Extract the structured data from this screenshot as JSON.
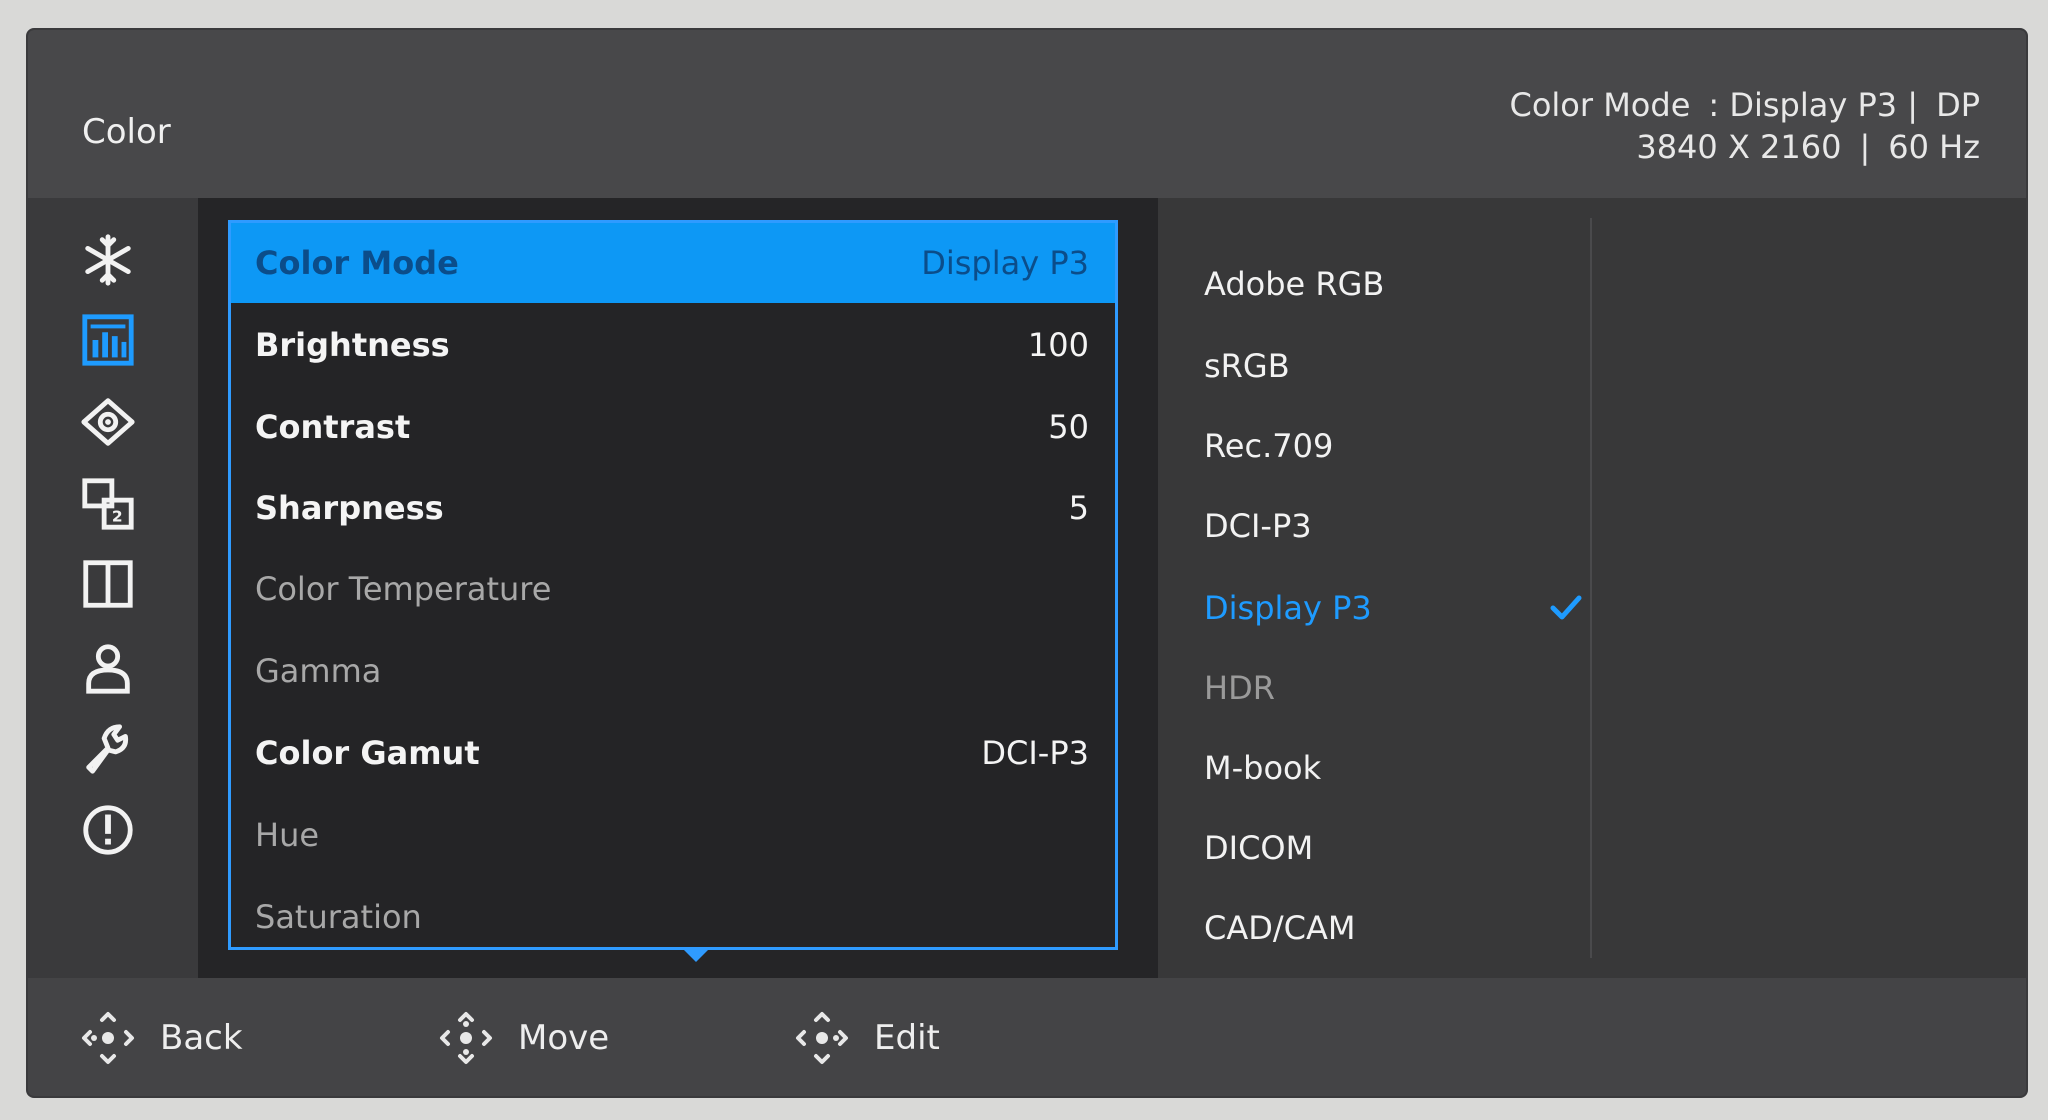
{
  "header": {
    "title": "Color",
    "info_line1": [
      "Color Mode",
      ": Display P3 |",
      "DP"
    ],
    "info_line2": [
      "3840 X 2160",
      "|",
      "60 Hz"
    ]
  },
  "rail": {
    "icons": [
      "snowflake-icon",
      "color-chart-icon",
      "eye-icon",
      "picture-in-picture-icon",
      "split-screen-icon",
      "user-icon",
      "wrench-icon",
      "info-icon"
    ],
    "active_index": 1
  },
  "menu": {
    "items": [
      {
        "label": "Color Mode",
        "value": "Display P3",
        "state": "active"
      },
      {
        "label": "Brightness",
        "value": "100",
        "state": "enabled"
      },
      {
        "label": "Contrast",
        "value": "50",
        "state": "enabled"
      },
      {
        "label": "Sharpness",
        "value": "5",
        "state": "enabled"
      },
      {
        "label": "Color Temperature",
        "value": "",
        "state": "disabled"
      },
      {
        "label": "Gamma",
        "value": "",
        "state": "disabled"
      },
      {
        "label": "Color Gamut",
        "value": "DCI-P3",
        "state": "enabled"
      },
      {
        "label": "Hue",
        "value": "",
        "state": "disabled"
      },
      {
        "label": "Saturation",
        "value": "",
        "state": "disabled"
      }
    ]
  },
  "options": {
    "items": [
      {
        "label": "Adobe RGB",
        "state": "enabled"
      },
      {
        "label": "sRGB",
        "state": "enabled"
      },
      {
        "label": "Rec.709",
        "state": "enabled"
      },
      {
        "label": "DCI-P3",
        "state": "enabled"
      },
      {
        "label": "Display P3",
        "state": "selected"
      },
      {
        "label": "HDR",
        "state": "disabled"
      },
      {
        "label": "M-book",
        "state": "enabled"
      },
      {
        "label": "DICOM",
        "state": "enabled"
      },
      {
        "label": "CAD/CAM",
        "state": "enabled"
      }
    ]
  },
  "footer": {
    "back_label": "Back",
    "move_label": "Move",
    "edit_label": "Edit"
  },
  "colors": {
    "accent": "#0d98f5",
    "selected_text": "#1e9bff"
  }
}
